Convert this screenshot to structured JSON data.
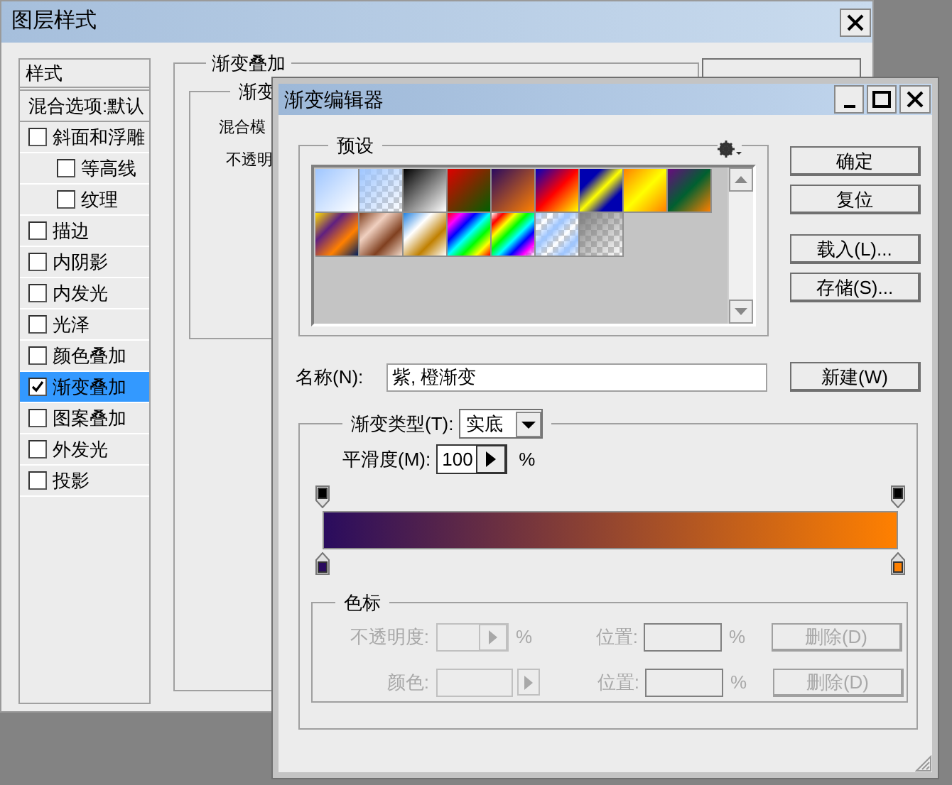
{
  "layer_style_window": {
    "title": "图层样式",
    "styles_list": [
      {
        "kind": "header",
        "label": "样式"
      },
      {
        "kind": "option",
        "label": "混合选项:默认",
        "selected": false
      },
      {
        "kind": "checkbox",
        "label": "斜面和浮雕",
        "checked": false,
        "selected": false,
        "children": [
          {
            "kind": "checkbox",
            "label": "等高线",
            "checked": false,
            "selected": false
          },
          {
            "kind": "checkbox",
            "label": "纹理",
            "checked": false,
            "selected": false
          }
        ]
      },
      {
        "kind": "checkbox",
        "label": "描边",
        "checked": false,
        "selected": false
      },
      {
        "kind": "checkbox",
        "label": "内阴影",
        "checked": false,
        "selected": false
      },
      {
        "kind": "checkbox",
        "label": "内发光",
        "checked": false,
        "selected": false
      },
      {
        "kind": "checkbox",
        "label": "光泽",
        "checked": false,
        "selected": false
      },
      {
        "kind": "checkbox",
        "label": "颜色叠加",
        "checked": false,
        "selected": false
      },
      {
        "kind": "checkbox",
        "label": "渐变叠加",
        "checked": true,
        "selected": true
      },
      {
        "kind": "checkbox",
        "label": "图案叠加",
        "checked": false,
        "selected": false
      },
      {
        "kind": "checkbox",
        "label": "外发光",
        "checked": false,
        "selected": false
      },
      {
        "kind": "checkbox",
        "label": "投影",
        "checked": false,
        "selected": false
      }
    ],
    "panel": {
      "group_title": "渐变叠加",
      "subgroup_title": "渐变",
      "labels": [
        "混合模",
        "不透明"
      ]
    }
  },
  "gradient_editor": {
    "title": "渐变编辑器",
    "presets": {
      "title": "预设"
    },
    "buttons": [
      "确定",
      "复位",
      "载入(L)...",
      "存储(S)..."
    ],
    "name": {
      "label": "名称(N):",
      "value": "紫, 橙渐变"
    },
    "new_button": "新建(W)",
    "gradient_type": {
      "label": "渐变类型(T):",
      "value": "实底"
    },
    "smoothness": {
      "label": "平滑度(M):",
      "value": "100",
      "unit": "%"
    },
    "opacity_stops": [
      {
        "color": "#000000"
      },
      {
        "color": "#000000"
      }
    ],
    "color_stops": [
      {
        "color": "#2a0c5e"
      },
      {
        "color": "#ff8000"
      }
    ],
    "stops_group": {
      "title": "色标",
      "rows": [
        {
          "kind": "opacity",
          "label": "不透明度:",
          "unit": "%",
          "position_label": "位置:",
          "position_unit": "%",
          "delete": "删除(D)",
          "disabled": true
        },
        {
          "kind": "color",
          "label": "颜色:",
          "position_label": "位置:",
          "position_unit": "%",
          "delete": "删除(D)",
          "disabled": true
        }
      ]
    }
  }
}
